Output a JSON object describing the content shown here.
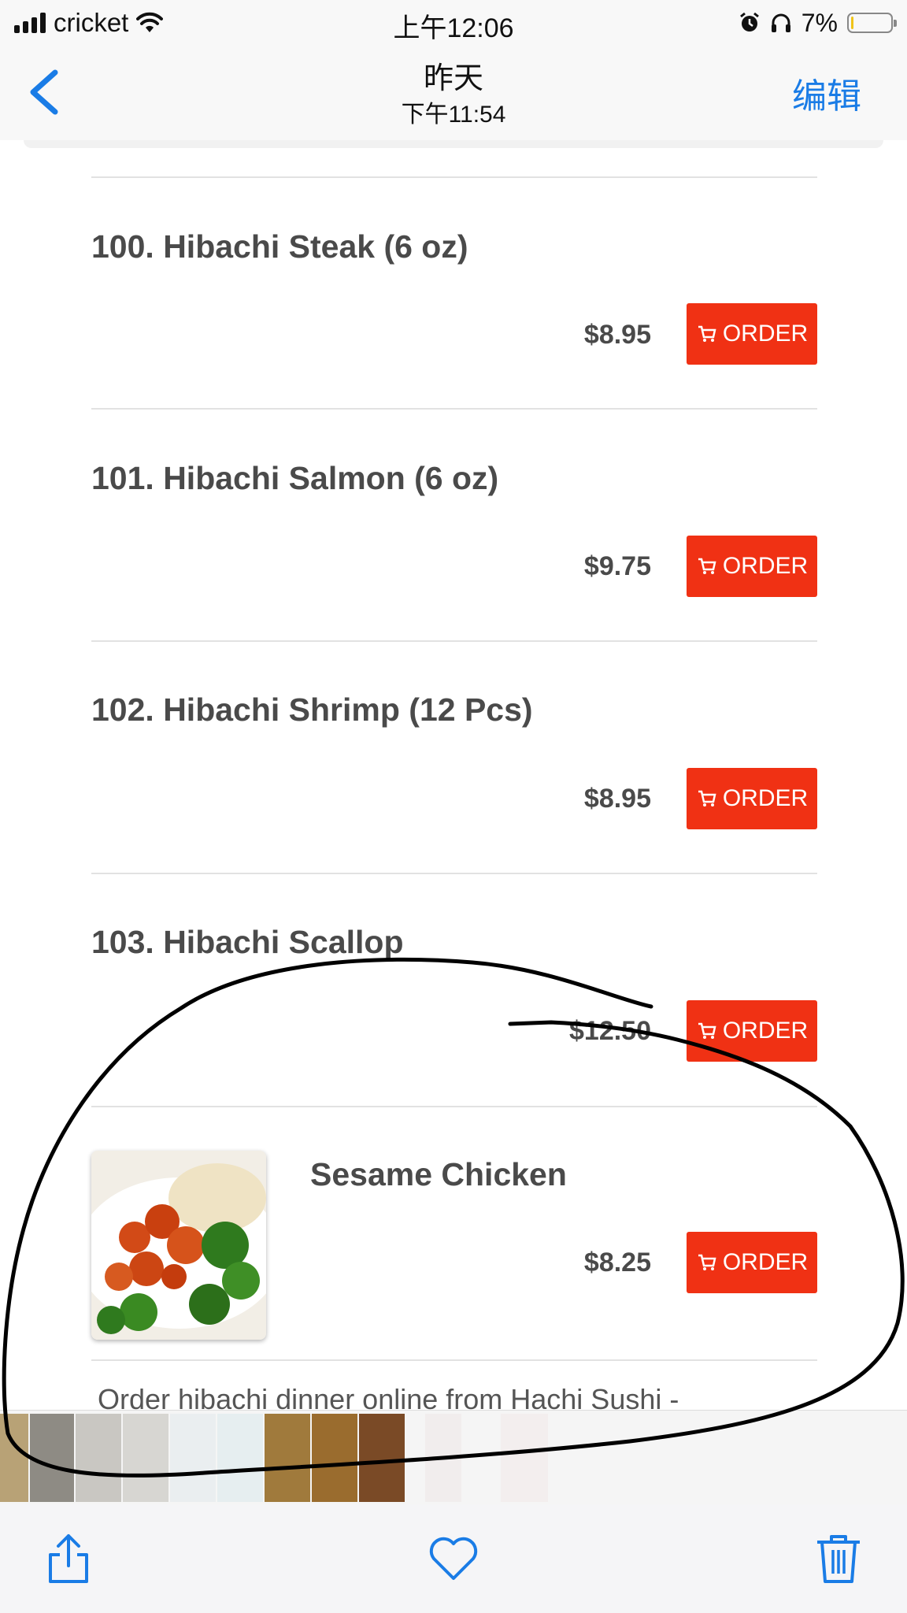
{
  "status_bar": {
    "carrier": "cricket",
    "time": "上午12:06",
    "battery_percent": "7%",
    "battery_level": 0.07
  },
  "nav": {
    "title": "昨天",
    "subtitle": "下午11:54",
    "edit_label": "编辑"
  },
  "menu": {
    "order_label": "ORDER",
    "items": [
      {
        "name": "100. Hibachi Steak (6 oz)",
        "price": "$8.95"
      },
      {
        "name": "101. Hibachi Salmon (6 oz)",
        "price": "$9.75"
      },
      {
        "name": "102. Hibachi Shrimp (12 Pcs)",
        "price": "$8.95"
      },
      {
        "name": "103. Hibachi Scallop",
        "price": "$12.50"
      },
      {
        "name": "Sesame Chicken",
        "price": "$8.25"
      }
    ],
    "cutoff_text": "Order hibachi dinner online from Hachi Sushi -"
  },
  "toolbar": {
    "share_icon": "share-icon",
    "like_icon": "heart-icon",
    "delete_icon": "trash-icon"
  },
  "colors": {
    "order_button": "#f03114",
    "ios_blue": "#1a7ce6",
    "battery_fill": "#f0c419"
  }
}
